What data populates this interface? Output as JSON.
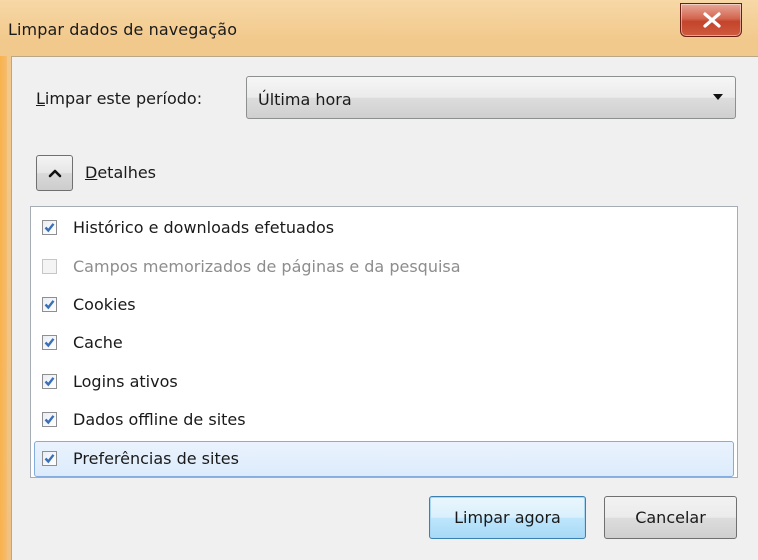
{
  "window": {
    "title": "Limpar dados de navegação",
    "close_icon": "close-x-icon"
  },
  "period": {
    "label_prefix": "L",
    "label_rest": "impar este período:",
    "selected": "Última hora"
  },
  "details": {
    "toggle_icon": "chevron-up-icon",
    "label_prefix": "D",
    "label_rest": "etalhes"
  },
  "items": [
    {
      "label": "Histórico e downloads efetuados",
      "checked": true,
      "enabled": true
    },
    {
      "label": "Campos memorizados de páginas e da pesquisa",
      "checked": false,
      "enabled": false
    },
    {
      "label": "Cookies",
      "checked": true,
      "enabled": true
    },
    {
      "label": "Cache",
      "checked": true,
      "enabled": true
    },
    {
      "label": "Logins ativos",
      "checked": true,
      "enabled": true
    },
    {
      "label": "Dados offline de sites",
      "checked": true,
      "enabled": true
    },
    {
      "label": "Preferências de sites",
      "checked": true,
      "enabled": true
    }
  ],
  "buttons": {
    "clear_now": "Limpar agora",
    "cancel": "Cancelar"
  },
  "colors": {
    "frame": "#f0c98e",
    "close_button": "#c3442b",
    "check_blue": "#3b6fb6",
    "selection": "#dcebfc"
  }
}
